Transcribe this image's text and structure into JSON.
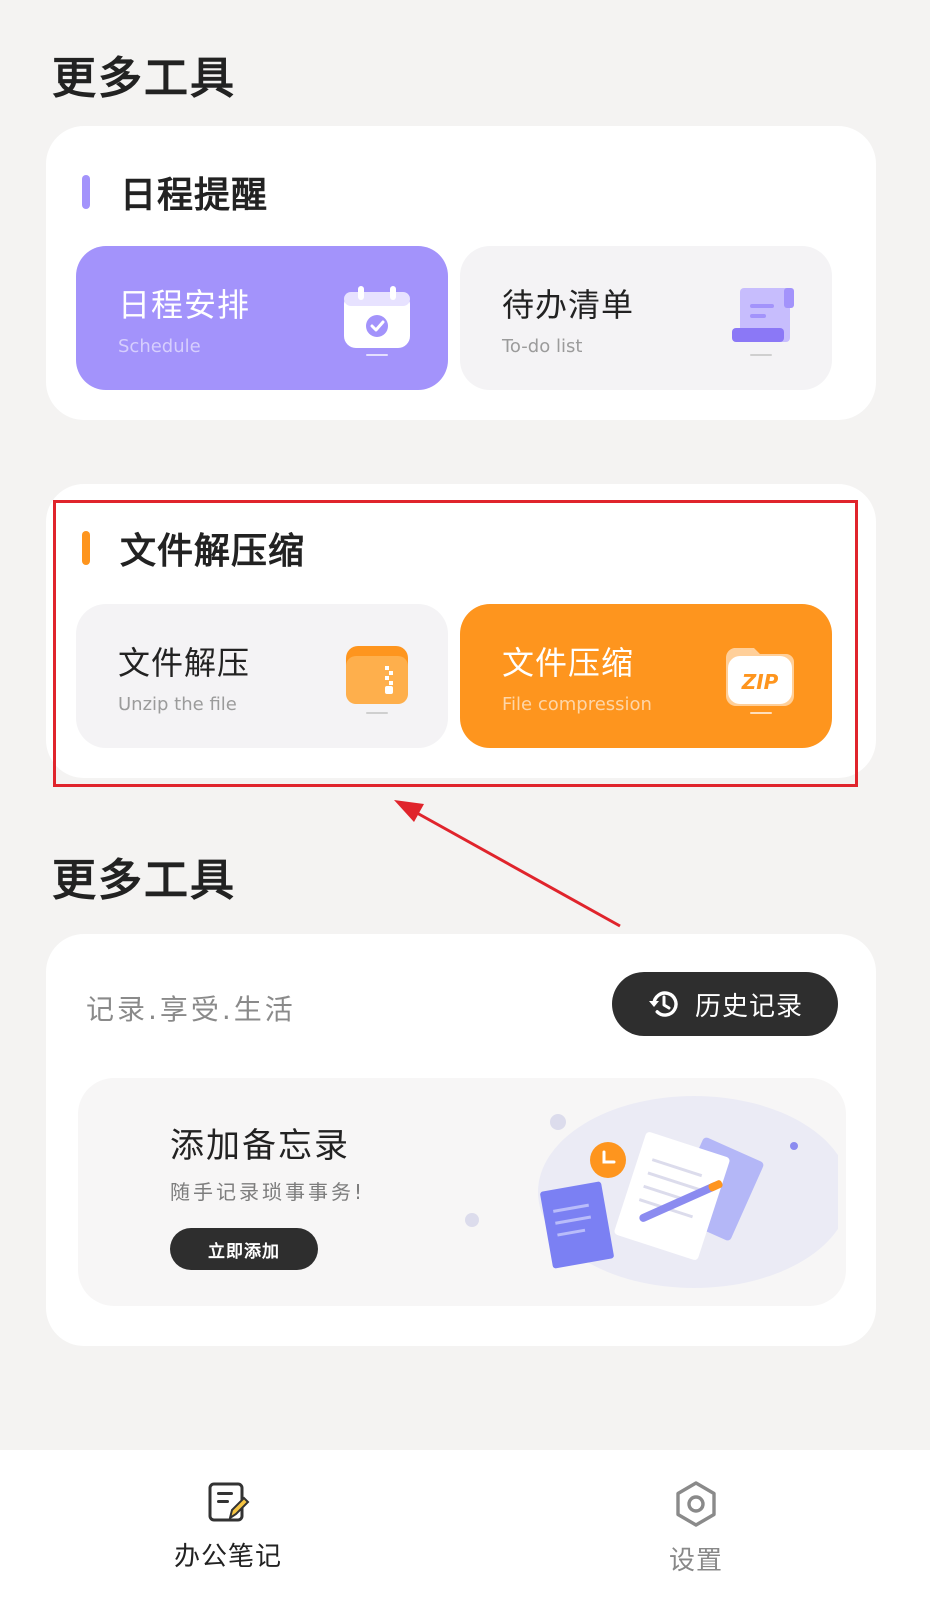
{
  "page": {
    "title": "更多工具"
  },
  "schedule_section": {
    "title": "日程提醒",
    "accent": "#a393fb",
    "tiles": [
      {
        "title": "日程安排",
        "subtitle": "Schedule",
        "icon": "calendar-check-icon"
      },
      {
        "title": "待办清单",
        "subtitle": "To-do list",
        "icon": "scroll-list-icon"
      }
    ]
  },
  "file_section": {
    "title": "文件解压缩",
    "accent": "#fe951e",
    "tiles": [
      {
        "title": "文件解压",
        "subtitle": "Unzip the file",
        "icon": "zip-folder-icon"
      },
      {
        "title": "文件压缩",
        "subtitle": "File compression",
        "icon": "zip-badge-icon",
        "badge": "ZIP"
      }
    ]
  },
  "more_tools": {
    "title": "更多工具",
    "slogan": "记录.享受.生活",
    "history_button": {
      "label": "历史记录",
      "icon": "history-icon"
    },
    "memo": {
      "title": "添加备忘录",
      "subtitle": "随手记录琐事事务!",
      "button": "立即添加"
    }
  },
  "tabbar": {
    "tabs": [
      {
        "label": "办公笔记",
        "icon": "note-edit-icon",
        "active": true
      },
      {
        "label": "设置",
        "icon": "hexagon-settings-icon",
        "active": false
      }
    ]
  },
  "annotation": {
    "color": "#e0242c"
  }
}
